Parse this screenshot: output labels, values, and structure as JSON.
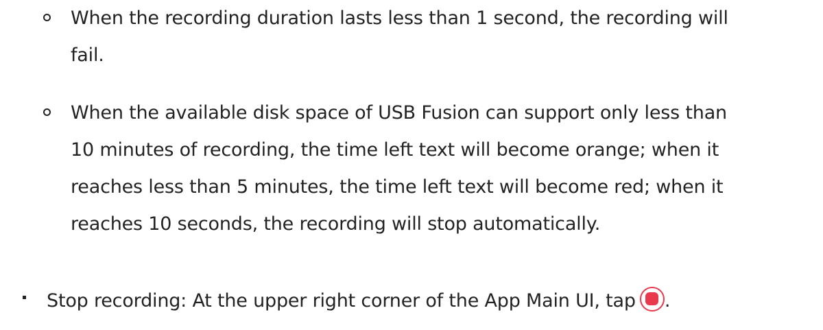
{
  "notes": {
    "item1": {
      "lines": [
        "When the recording duration lasts less than 1 second, the recording will",
        "fail."
      ]
    },
    "item2": {
      "lines": [
        "When the available disk space of USB Fusion can support only less than",
        "10 minutes of recording, the time left text will become orange; when it",
        "reaches less than 5 minutes, the time left text will become red; when it",
        "reaches 10 seconds, the recording will stop automatically."
      ]
    }
  },
  "stop_recording": {
    "text": "Stop recording: At the upper right corner of the App Main UI, tap",
    "icon": "stop-record-icon",
    "icon_color": "#e8394d",
    "trailing": "."
  }
}
